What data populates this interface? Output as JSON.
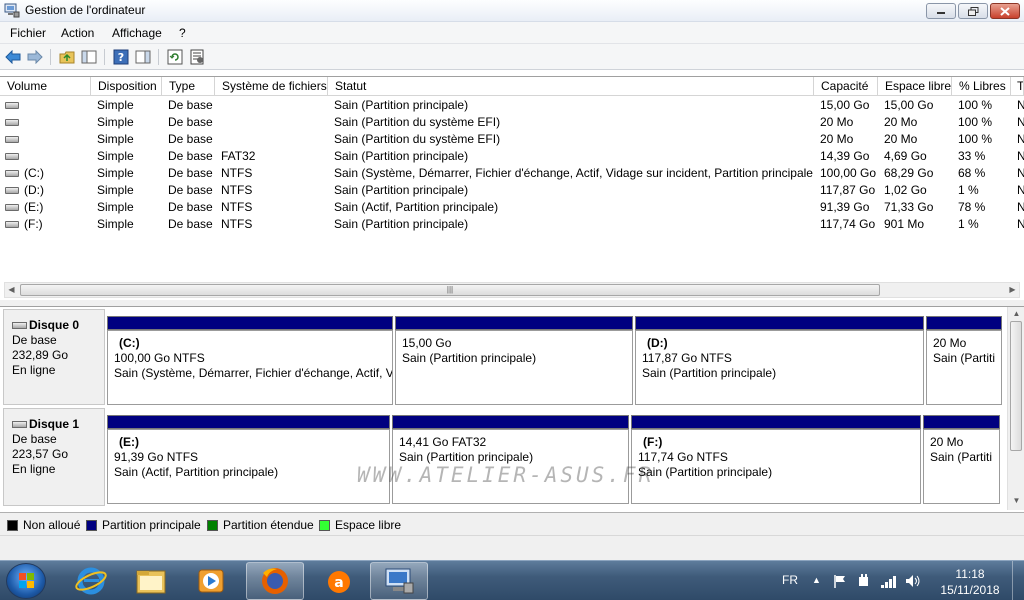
{
  "window": {
    "title": "Gestion de l'ordinateur"
  },
  "menu": [
    "Fichier",
    "Action",
    "Affichage",
    "?"
  ],
  "columns": [
    "Volume",
    "Disposition",
    "Type",
    "Système de fichiers",
    "Statut",
    "Capacité",
    "Espace libre",
    "% Libres",
    "T"
  ],
  "volumes": [
    {
      "volume": "",
      "disposition": "Simple",
      "type": "De base",
      "fs": "",
      "statut": "Sain (Partition principale)",
      "capacite": "15,00 Go",
      "libre": "15,00 Go",
      "pct": "100 %",
      "t": "N"
    },
    {
      "volume": "",
      "disposition": "Simple",
      "type": "De base",
      "fs": "",
      "statut": "Sain (Partition du système EFI)",
      "capacite": "20 Mo",
      "libre": "20 Mo",
      "pct": "100 %",
      "t": "N"
    },
    {
      "volume": "",
      "disposition": "Simple",
      "type": "De base",
      "fs": "",
      "statut": "Sain (Partition du système EFI)",
      "capacite": "20 Mo",
      "libre": "20 Mo",
      "pct": "100 %",
      "t": "N"
    },
    {
      "volume": "",
      "disposition": "Simple",
      "type": "De base",
      "fs": "FAT32",
      "statut": "Sain (Partition principale)",
      "capacite": "14,39 Go",
      "libre": "4,69 Go",
      "pct": "33 %",
      "t": "N"
    },
    {
      "volume": "(C:)",
      "disposition": "Simple",
      "type": "De base",
      "fs": "NTFS",
      "statut": "Sain (Système, Démarrer, Fichier d'échange, Actif, Vidage sur incident, Partition principale)",
      "capacite": "100,00 Go",
      "libre": "68,29 Go",
      "pct": "68 %",
      "t": "N"
    },
    {
      "volume": "(D:)",
      "disposition": "Simple",
      "type": "De base",
      "fs": "NTFS",
      "statut": "Sain (Partition principale)",
      "capacite": "117,87 Go",
      "libre": "1,02 Go",
      "pct": "1 %",
      "t": "N"
    },
    {
      "volume": "(E:)",
      "disposition": "Simple",
      "type": "De base",
      "fs": "NTFS",
      "statut": "Sain (Actif, Partition principale)",
      "capacite": "91,39 Go",
      "libre": "71,33 Go",
      "pct": "78 %",
      "t": "N"
    },
    {
      "volume": "(F:)",
      "disposition": "Simple",
      "type": "De base",
      "fs": "NTFS",
      "statut": "Sain (Partition principale)",
      "capacite": "117,74 Go",
      "libre": "901 Mo",
      "pct": "1 %",
      "t": "N"
    }
  ],
  "disks": [
    {
      "name": "Disque 0",
      "type": "De base",
      "size": "232,89 Go",
      "state": "En ligne",
      "partitions": [
        {
          "label": "(C:)",
          "size": "100,00 Go NTFS",
          "status": "Sain (Système, Démarrer, Fichier d'échange, Actif, V"
        },
        {
          "label": "",
          "size": "15,00 Go",
          "status": "Sain (Partition principale)"
        },
        {
          "label": "(D:)",
          "size": "117,87 Go NTFS",
          "status": "Sain (Partition principale)"
        },
        {
          "label": "",
          "size": "20 Mo",
          "status": "Sain (Partiti"
        }
      ]
    },
    {
      "name": "Disque 1",
      "type": "De base",
      "size": "223,57 Go",
      "state": "En ligne",
      "partitions": [
        {
          "label": "(E:)",
          "size": "91,39 Go NTFS",
          "status": "Sain (Actif, Partition principale)"
        },
        {
          "label": "",
          "size": "14,41 Go FAT32",
          "status": "Sain (Partition principale)"
        },
        {
          "label": "(F:)",
          "size": "117,74 Go NTFS",
          "status": "Sain (Partition principale)"
        },
        {
          "label": "",
          "size": "20 Mo",
          "status": "Sain (Partiti"
        }
      ]
    }
  ],
  "legend": [
    {
      "label": "Non alloué",
      "color": "#000000"
    },
    {
      "label": "Partition principale",
      "color": "#000080"
    },
    {
      "label": "Partition étendue",
      "color": "#008000"
    },
    {
      "label": "Espace libre",
      "color": "#33ff33"
    }
  ],
  "watermark": "WWW.ATELIER-ASUS.FR",
  "taskbar": {
    "lang": "FR",
    "time": "11:18",
    "date": "15/11/2018"
  }
}
